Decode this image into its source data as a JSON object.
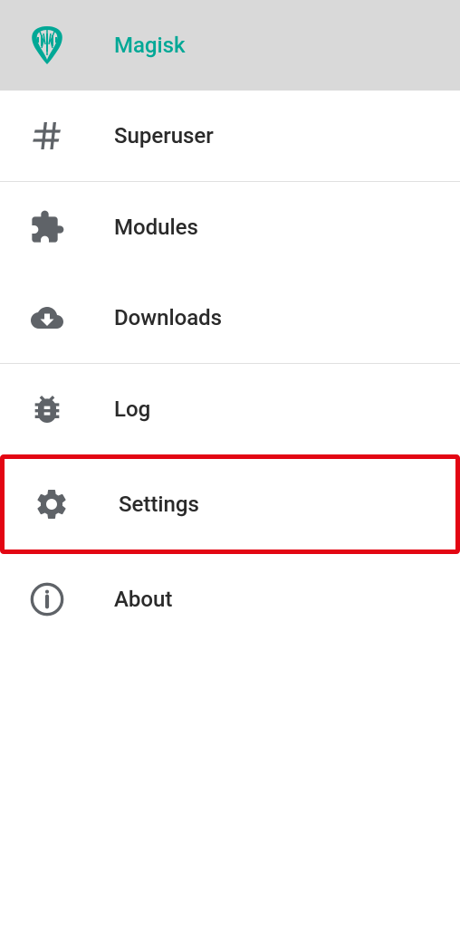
{
  "menu": {
    "items": [
      {
        "label": "Magisk",
        "icon": "magisk-logo-icon",
        "active": true
      },
      {
        "label": "Superuser",
        "icon": "hash-icon",
        "active": false
      },
      {
        "label": "Modules",
        "icon": "puzzle-icon",
        "active": false
      },
      {
        "label": "Downloads",
        "icon": "cloud-download-icon",
        "active": false
      },
      {
        "label": "Log",
        "icon": "bug-icon",
        "active": false
      },
      {
        "label": "Settings",
        "icon": "gear-icon",
        "active": false,
        "highlighted": true
      },
      {
        "label": "About",
        "icon": "info-icon",
        "active": false
      }
    ]
  },
  "colors": {
    "accent": "#00a896",
    "icon": "#5f6368",
    "highlight": "#e30613",
    "active_bg": "#d9d9d9"
  }
}
